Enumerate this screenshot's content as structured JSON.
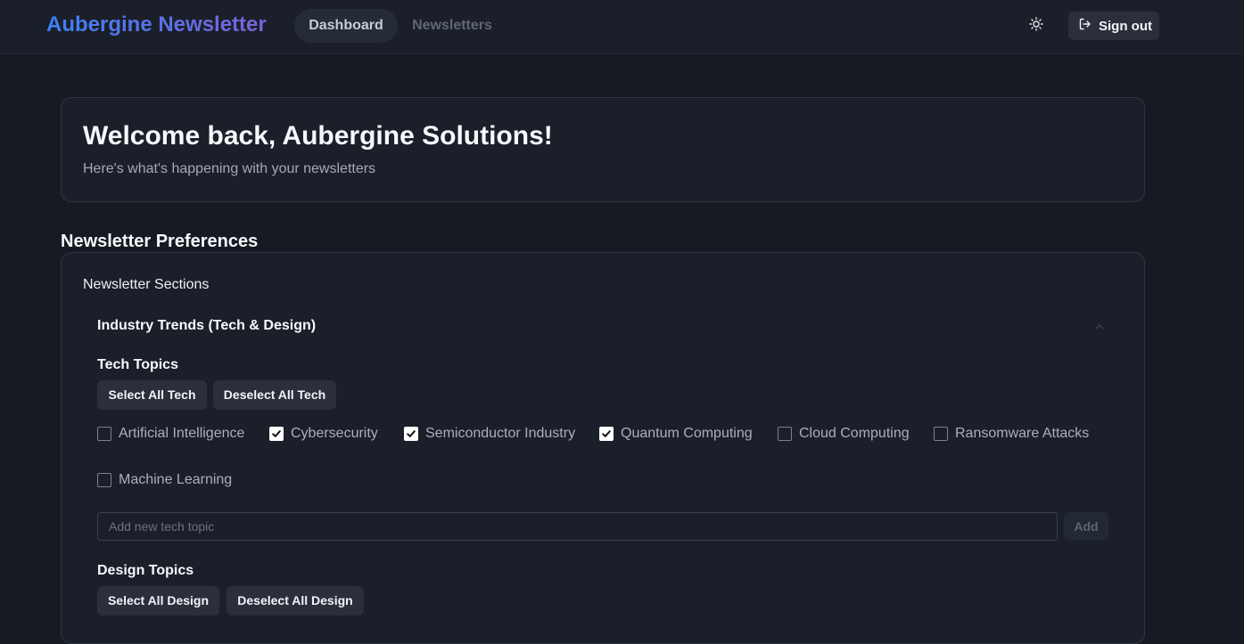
{
  "header": {
    "brand": "Aubergine Newsletter",
    "nav": [
      {
        "label": "Dashboard",
        "active": true
      },
      {
        "label": "Newsletters",
        "active": false
      }
    ],
    "theme_icon": "sun-icon",
    "signout_icon": "sign-out-icon",
    "signout_label": "Sign out"
  },
  "welcome": {
    "title": "Welcome back, Aubergine Solutions!",
    "subtitle": "Here's what's happening with your newsletters"
  },
  "preferences": {
    "heading": "Newsletter Preferences",
    "sections_label": "Newsletter Sections",
    "section": {
      "title": "Industry Trends (Tech & Design)",
      "expanded": true,
      "chevron_icon": "chevron-up-icon",
      "tech": {
        "title": "Tech Topics",
        "select_all": "Select All Tech",
        "deselect_all": "Deselect All Tech",
        "topics": [
          {
            "label": "Artificial Intelligence",
            "checked": false
          },
          {
            "label": "Cybersecurity",
            "checked": true
          },
          {
            "label": "Semiconductor Industry",
            "checked": true
          },
          {
            "label": "Quantum Computing",
            "checked": true
          },
          {
            "label": "Cloud Computing",
            "checked": false
          },
          {
            "label": "Ransomware Attacks",
            "checked": false
          },
          {
            "label": "Machine Learning",
            "checked": false
          }
        ],
        "input_placeholder": "Add new tech topic",
        "add_label": "Add"
      },
      "design": {
        "title": "Design Topics",
        "select_all": "Select All Design",
        "deselect_all": "Deselect All Design"
      }
    }
  },
  "colors": {
    "background": "#171a22",
    "surface": "#1b1f29",
    "brand_gradient_start": "#3b82f6",
    "brand_gradient_end": "#7b61d8"
  }
}
